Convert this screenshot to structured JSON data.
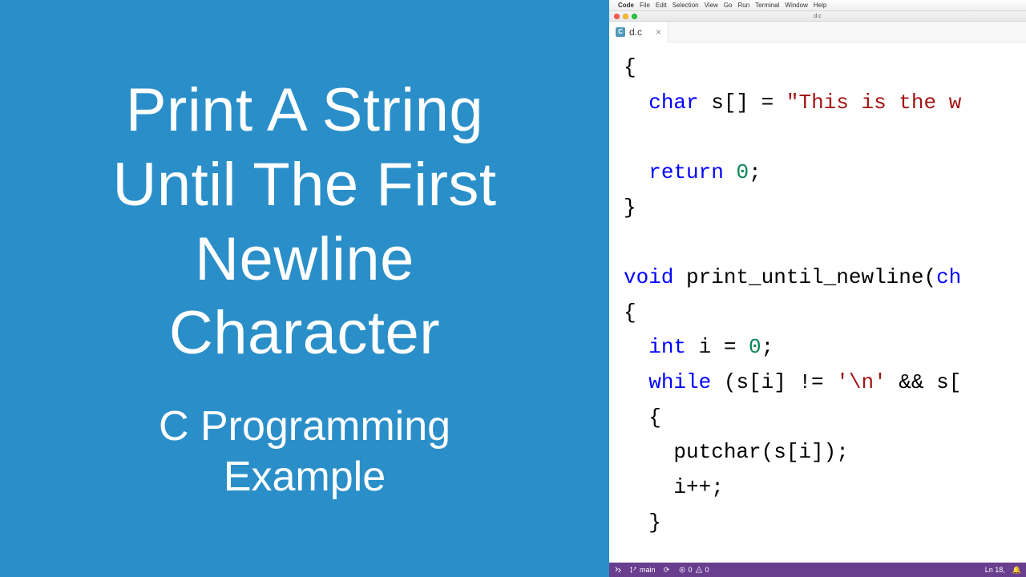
{
  "left": {
    "title_l1": "Print A String",
    "title_l2": "Until The First",
    "title_l3": "Newline",
    "title_l4": "Character",
    "subtitle_l1": "C Programming",
    "subtitle_l2": "Example"
  },
  "menubar": {
    "app": "Code",
    "items": [
      "File",
      "Edit",
      "Selection",
      "View",
      "Go",
      "Run",
      "Terminal",
      "Window",
      "Help"
    ]
  },
  "window": {
    "title": "d.c"
  },
  "tab": {
    "icon": "C",
    "name": "d.c",
    "close": "×"
  },
  "code": {
    "l1_brace": "{",
    "l2_kw": "char",
    "l2_rest": " s[] = ",
    "l2_str": "\"This is the w",
    "l3": "",
    "l4_kw": "return",
    "l4_rest": " ",
    "l4_num": "0",
    "l4_semi": ";",
    "l5_brace": "}",
    "l6": "",
    "l7_kw": "void",
    "l7_rest": " print_until_newline(",
    "l7_kw2": "ch",
    "l8_brace": "{",
    "l9_kw": "int",
    "l9_rest": " i = ",
    "l9_num": "0",
    "l9_semi": ";",
    "l10_kw": "while",
    "l10_rest": " (s[i] != ",
    "l10_str": "'\\n'",
    "l10_rest2": " && s[",
    "l11_brace": "  {",
    "l12": "    putchar(s[i]);",
    "l13": "    i++;",
    "l14_brace": "  }"
  },
  "status": {
    "remote": "⌃",
    "branch": "main",
    "sync": "⟳",
    "errors": "0",
    "warnings": "0",
    "position": "Ln 18,",
    "bell": "🔔"
  }
}
